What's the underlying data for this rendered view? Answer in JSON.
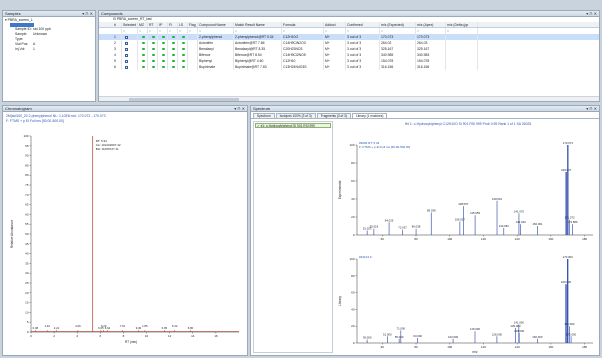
{
  "samples_panel": {
    "title": "Samples",
    "controls": "▾ ⊓ ✕",
    "tree_root": "PBRA_screen_1",
    "tree_selected": "",
    "props": [
      {
        "k": "Sample ID:",
        "v": "std 100 ppb"
      },
      {
        "k": "Sample Type:",
        "v": "Unknown"
      },
      {
        "k": "Vial Pos:",
        "v": "A"
      },
      {
        "k": "Inj Vol:",
        "v": "1"
      }
    ]
  },
  "compounds_panel": {
    "title": "Compounds",
    "controls": "▾ ⊓ ✕",
    "file": "PBRA_screen_RT_last",
    "headers": [
      "#",
      "Selected",
      "MZ",
      "RT",
      "IP",
      "FI",
      "LS",
      "Flag",
      "Compound Name",
      "Match Result Name",
      "Formula",
      "Adduct",
      "Confirmed",
      "m/z (Expected)",
      "m/z (Apex)",
      "m/z (Delta (pp"
    ],
    "filter_glyph": "=",
    "rows": [
      {
        "n": "1",
        "name": "2-phenylphenol",
        "match": "2-phenylphenol@RT 5.34",
        "formula": "C12H10O",
        "adduct": "M+",
        "conf": "3 out of 3",
        "exp": "170.073",
        "apex": "170.073"
      },
      {
        "n": "2",
        "name": "Actonifen",
        "match": "Actonifen@RT 7.86",
        "formula": "C14H9ClN2O3",
        "adduct": "M+",
        "conf": "3 out of 3",
        "exp": "264.02",
        "apex": "264.03"
      },
      {
        "n": "3",
        "name": "Benalaxyl",
        "match": "Benalaxyl@RT 8.35",
        "formula": "C20H23NO3",
        "adduct": "M+",
        "conf": "3 out of 3",
        "exp": "325.167",
        "apex": "325.167"
      },
      {
        "n": "4",
        "name": "Bifenox",
        "match": "Bifenox@RT 8.54",
        "formula": "C14H9Cl2NO5",
        "adduct": "M+",
        "conf": "3 out of 3",
        "exp": "340.985",
        "apex": "340.983"
      },
      {
        "n": "5",
        "name": "Biphenyl",
        "match": "Biphenyl@RT 4.60",
        "formula": "C12H10",
        "adduct": "M+",
        "conf": "3 out of 3",
        "exp": "154.078",
        "apex": "154.078"
      },
      {
        "n": "6",
        "name": "Bupirimate",
        "match": "Bupirimate@RT 7.83",
        "formula": "C13H24N4O3S",
        "adduct": "M+",
        "conf": "3 out of 3",
        "exp": "316.156",
        "apex": "316.156"
      }
    ]
  },
  "chromatogram_panel": {
    "title": "Chromatogram",
    "controls": "▾ ⊓ ✕",
    "info1": "2M(std100_20  2-phenylphenol   NL: 1.10E8   m/z: 170.072 - 170.073",
    "info2": "F: FTMS + p EI Full ms [50.00-500.00]",
    "peak_rt": "RT: 5.34",
    "peak_area": "AA: 102102097.42",
    "peak_bp": "BH: 11050727.11",
    "ylabel": "Relative Abundance",
    "xlabel": "RT (min)"
  },
  "spectrum_panel": {
    "title": "Spectrum",
    "controls": "▾ ⊓ ✕",
    "tabs": [
      "Spectrum",
      "Isotopes 100% (3 of 3)",
      "Fragments (3 of 3)",
      "Library (1 matches)"
    ],
    "hit_item": "#1: o-Hydroxybiphenyl  SI 901  RSI 999",
    "hit_header": "Hit 1: o-Hydroxybiphenyl  C12H10O  SI 901  RSI 999  Prob 0.95  Rank 1 of 1  SA 26025",
    "top_label": "#9096  RT: 5.34",
    "top_sub": "F: FTMS + p EI Full ms [50.00-500.00]",
    "bottom_label": "#24123  F:",
    "ylabel_top": "Experimental",
    "ylabel_bottom": "Library",
    "xlabel": "m/z"
  },
  "chart_data": [
    {
      "type": "line",
      "title": "",
      "xlabel": "RT (min)",
      "ylabel": "Relative Abundance",
      "xlim": [
        0,
        18
      ],
      "ylim": [
        0,
        100
      ],
      "x_ticks": [
        0,
        2,
        4,
        6,
        8,
        10,
        12,
        14,
        16
      ],
      "y_ticks": [
        0,
        5,
        10,
        15,
        20,
        25,
        30,
        35,
        40,
        45,
        50,
        55,
        60,
        65,
        70,
        75,
        80,
        85,
        90,
        95,
        100
      ],
      "peaks": [
        {
          "rt": 5.34,
          "value": 100
        }
      ],
      "annotations": [
        {
          "x": 0.38,
          "text": "0.38"
        },
        {
          "x": 1.4,
          "text": "1.40"
        },
        {
          "x": 2.21,
          "text": "2.21"
        },
        {
          "x": 4.06,
          "text": "4.06"
        },
        {
          "x": 6.05,
          "text": "6.05"
        },
        {
          "x": 6.29,
          "text": "6.29"
        },
        {
          "x": 6.62,
          "text": "6.62"
        },
        {
          "x": 7.91,
          "text": "7.91"
        },
        {
          "x": 9.3,
          "text": "9.30"
        },
        {
          "x": 9.85,
          "text": "1.85"
        },
        {
          "x": 11.54,
          "text": "6.95"
        },
        {
          "x": 12.44,
          "text": "6.22"
        },
        {
          "x": 13.8,
          "text": "6.80"
        }
      ]
    },
    {
      "type": "bar",
      "title": "",
      "xlabel": "m/z",
      "ylabel": "Experimental",
      "xlim": [
        45,
        185
      ],
      "ylim": [
        0,
        100
      ],
      "x_ticks": [
        60,
        80,
        100,
        120,
        140,
        160,
        180
      ],
      "peaks": [
        {
          "x": 51.023,
          "y": 5,
          "label": "51.023"
        },
        {
          "x": 55.018,
          "y": 7,
          "label": "55.018"
        },
        {
          "x": 64.025,
          "y": 14,
          "label": "64.025"
        },
        {
          "x": 72.037,
          "y": 6,
          "label": "72.037"
        },
        {
          "x": 80.038,
          "y": 7,
          "label": "80.038"
        },
        {
          "x": 89.038,
          "y": 25,
          "label": "89.038"
        },
        {
          "x": 106.03,
          "y": 15,
          "label": "106.027"
        },
        {
          "x": 108.057,
          "y": 32,
          "label": "108.057"
        },
        {
          "x": 115.055,
          "y": 22,
          "label": "115.055"
        },
        {
          "x": 128.061,
          "y": 38,
          "label": "128.061"
        },
        {
          "x": 132.081,
          "y": 8,
          "label": "132.081"
        },
        {
          "x": 141.07,
          "y": 24,
          "label": "141.070"
        },
        {
          "x": 142.049,
          "y": 12,
          "label": "142.049"
        },
        {
          "x": 152.061,
          "y": 10,
          "label": "152.061"
        },
        {
          "x": 169.07,
          "y": 70,
          "label": "169.007"
        },
        {
          "x": 170.073,
          "y": 100,
          "label": "170.073"
        },
        {
          "x": 171.072,
          "y": 17,
          "label": "171.072"
        },
        {
          "x": 172.866,
          "y": 12,
          "label": "172.866"
        }
      ]
    },
    {
      "type": "bar",
      "title": "",
      "xlabel": "m/z",
      "ylabel": "Library",
      "xlim": [
        45,
        185
      ],
      "ylim": [
        0,
        100
      ],
      "x_ticks": [
        60,
        80,
        100,
        120,
        140,
        160,
        180
      ],
      "peaks": [
        {
          "x": 51.0,
          "y": 4,
          "label": "39.000"
        },
        {
          "x": 63.0,
          "y": 8,
          "label": "51.000"
        },
        {
          "x": 71.0,
          "y": 15,
          "label": "71.000"
        },
        {
          "x": 70.0,
          "y": 5,
          "label": "55.000"
        },
        {
          "x": 81.0,
          "y": 6,
          "label": "63.000"
        },
        {
          "x": 102.0,
          "y": 5,
          "label": "102.000"
        },
        {
          "x": 115.0,
          "y": 14,
          "label": "115.000"
        },
        {
          "x": 128.0,
          "y": 8,
          "label": "128.000"
        },
        {
          "x": 139.0,
          "y": 18,
          "label": "139.000"
        },
        {
          "x": 141.0,
          "y": 22,
          "label": "141.000"
        },
        {
          "x": 141.2,
          "y": 12,
          "label": "128.000"
        },
        {
          "x": 152.0,
          "y": 5,
          "label": "152.000"
        },
        {
          "x": 169.0,
          "y": 70,
          "label": "169.000"
        },
        {
          "x": 170.0,
          "y": 100,
          "label": "170.000"
        },
        {
          "x": 171.0,
          "y": 20,
          "label": "171.000"
        },
        {
          "x": 172.0,
          "y": 8,
          "label": "172.000"
        }
      ]
    }
  ]
}
